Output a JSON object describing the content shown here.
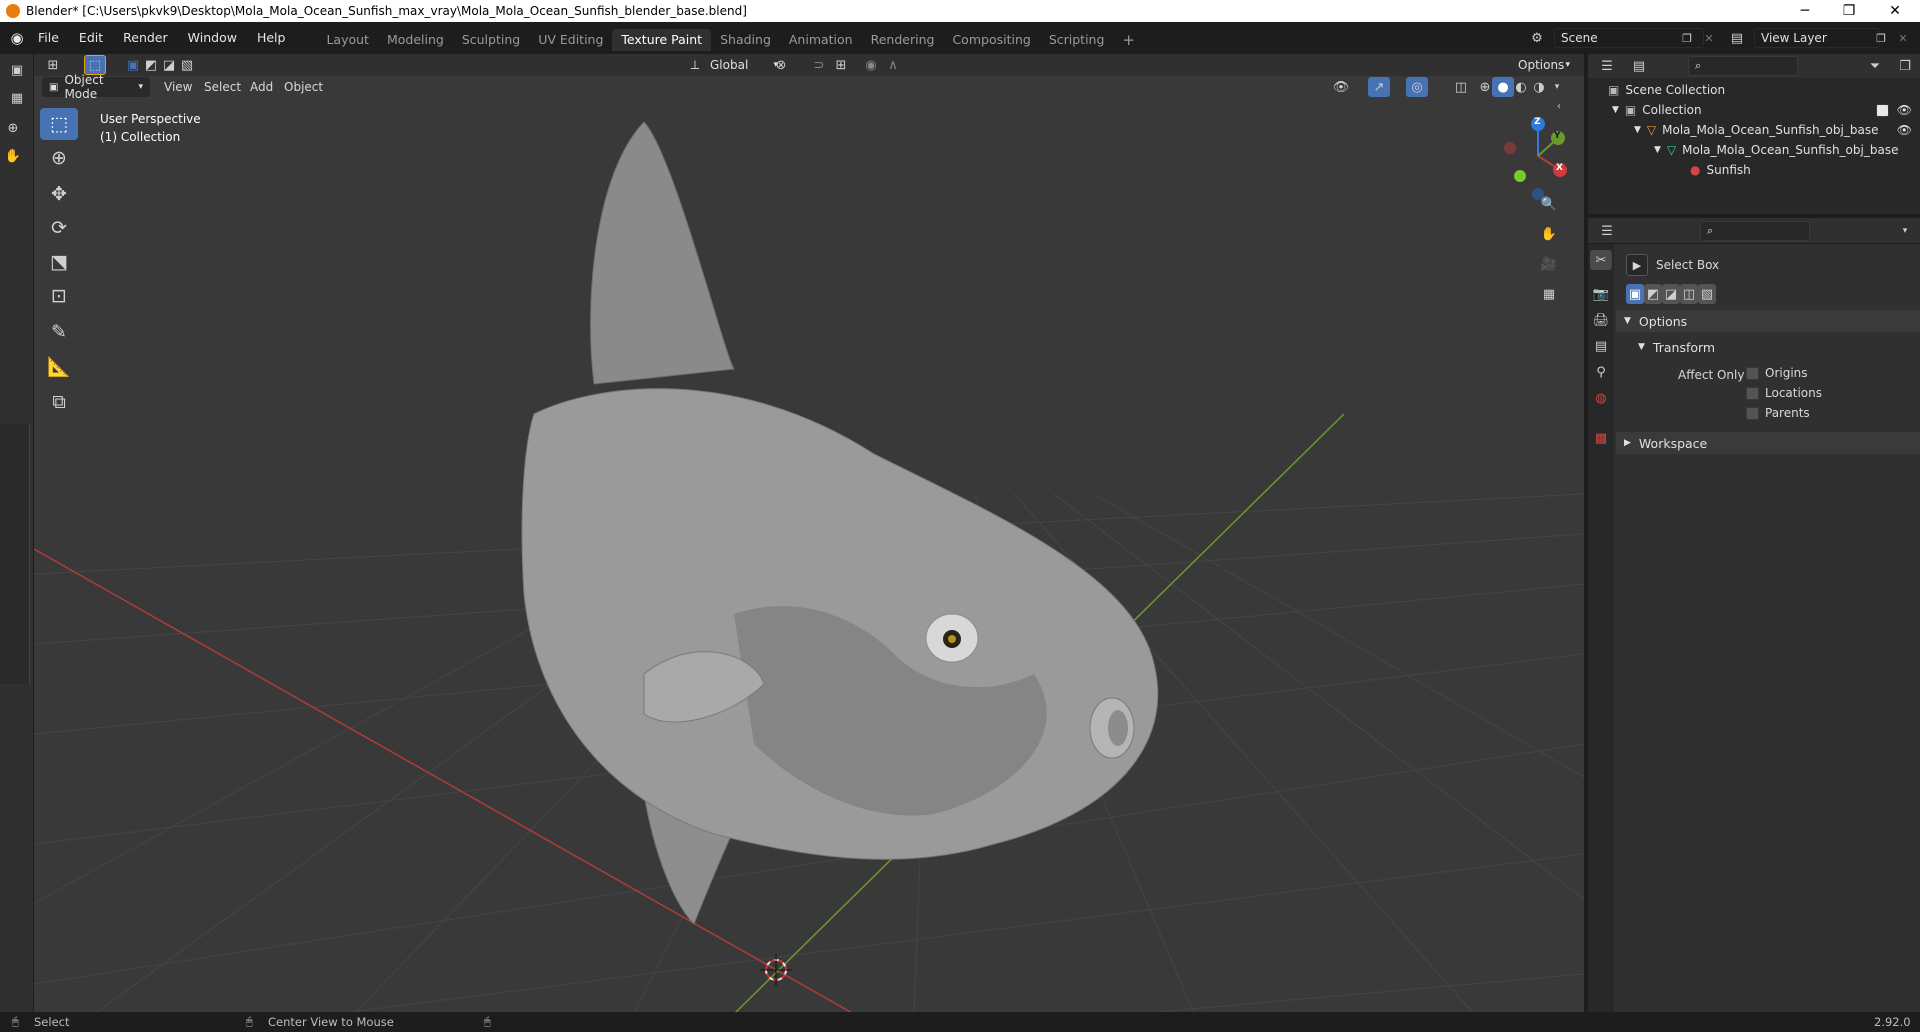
{
  "titlebar": {
    "title": "Blender* [C:\\Users\\pkvk9\\Desktop\\Mola_Mola_Ocean_Sunfish_max_vray\\Mola_Mola_Ocean_Sunfish_blender_base.blend]",
    "minimize": "─",
    "maximize": "❐",
    "close": "✕"
  },
  "menubar": {
    "menus": [
      "File",
      "Edit",
      "Render",
      "Window",
      "Help"
    ],
    "workspaces": [
      "Layout",
      "Modeling",
      "Sculpting",
      "UV Editing",
      "Texture Paint",
      "Shading",
      "Animation",
      "Rendering",
      "Compositing",
      "Scripting"
    ],
    "active_workspace": "Texture Paint",
    "add_tab": "+",
    "scene": "Scene",
    "view_layer": "View Layer"
  },
  "viewport_header": {
    "transform_orientation": "Global",
    "options_label": "Options",
    "mode": "Object Mode",
    "menus": [
      "View",
      "Select",
      "Add",
      "Object"
    ]
  },
  "viewport": {
    "perspective_label": "User Perspective",
    "collection_label": "(1) Collection",
    "gizmo_axes": {
      "x": "X",
      "y": "Y",
      "z": "Z"
    }
  },
  "outliner": {
    "scene_collection": "Scene Collection",
    "collection": "Collection",
    "object": "Mola_Mola_Ocean_Sunfish_obj_base",
    "mesh": "Mola_Mola_Ocean_Sunfish_obj_base",
    "material": "Sunfish"
  },
  "properties": {
    "tool_name": "Select Box",
    "options_panel": "Options",
    "transform_panel": "Transform",
    "affect_only_label": "Affect Only",
    "checkboxes": [
      {
        "label": "Origins",
        "checked": false
      },
      {
        "label": "Locations",
        "checked": false
      },
      {
        "label": "Parents",
        "checked": false
      }
    ],
    "workspace_panel": "Workspace"
  },
  "statusbar": {
    "select_label": "Select",
    "center_view_label": "Center View to Mouse",
    "version": "2.92.0"
  },
  "colors": {
    "accent": "#4772b3",
    "x_axis": "#b33a3a",
    "y_axis": "#6b9a2b",
    "z_axis": "#2f7bd9",
    "viewport_bg": "#393939"
  }
}
